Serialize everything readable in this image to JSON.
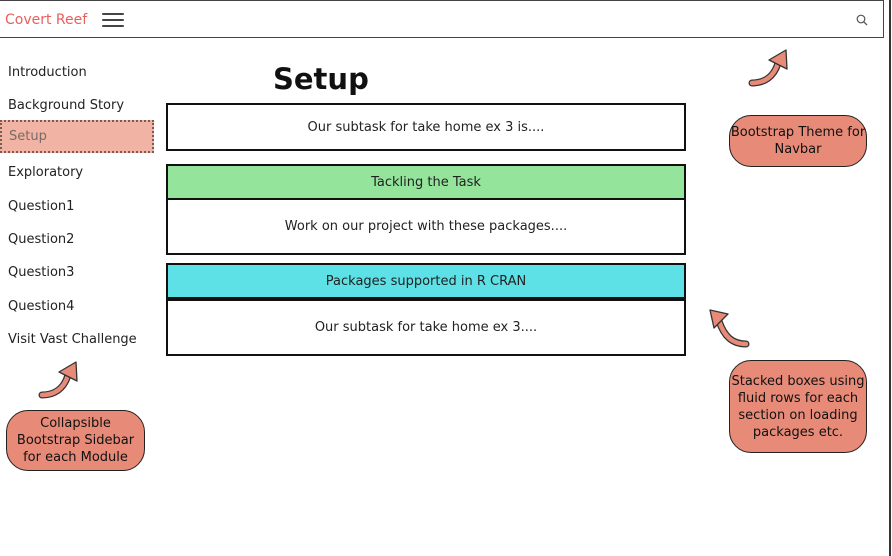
{
  "navbar": {
    "brand": "Covert Reef",
    "menu_icon": "hamburger-menu-icon",
    "search_icon": "search-icon"
  },
  "sidebar": {
    "items": [
      {
        "label": "Introduction"
      },
      {
        "label": "Background Story"
      },
      {
        "label": "Setup",
        "active": true
      },
      {
        "label": "Exploratory"
      },
      {
        "label": "Question1"
      },
      {
        "label": "Question2"
      },
      {
        "label": "Question3"
      },
      {
        "label": "Question4"
      },
      {
        "label": "Visit Vast Challenge"
      }
    ]
  },
  "main": {
    "title": "Setup",
    "boxes": {
      "subtask_top": "Our subtask for take home ex 3 is....",
      "tackling_header": "Tackling the Task",
      "tackling_body": "Work on our project with these packages....",
      "packages_header": "Packages supported in R CRAN",
      "packages_body": "Our subtask for take home ex 3...."
    }
  },
  "annotations": {
    "navbar_note": "Bootstrap Theme for Navbar",
    "sidebar_note": "Collapsible Bootstrap Sidebar for each Module",
    "boxes_note": "Stacked boxes using fluid rows for each section on loading packages etc."
  },
  "colors": {
    "brand": "#e8605e",
    "active_item": "#f1b3a3",
    "green_header": "#94e59b",
    "cyan_header": "#5de0e6",
    "bubble": "#e88a78"
  }
}
